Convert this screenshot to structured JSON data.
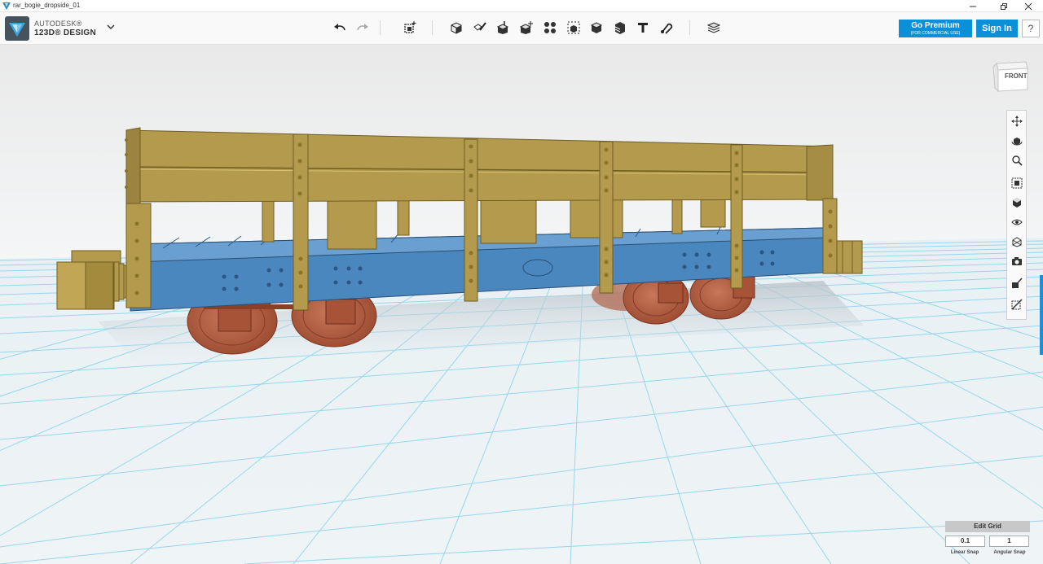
{
  "window": {
    "title": "rar_bogie_dropside_01"
  },
  "brand": {
    "line1": "AUTODESK®",
    "line2": "123D® DESIGN"
  },
  "toolbar": {
    "icons": [
      "undo-icon",
      "redo-icon",
      "transform-icon",
      "primitives-icon",
      "sketch-icon",
      "construct-icon",
      "modify-icon",
      "pattern-icon",
      "grouping-icon",
      "combine-icon",
      "measure-icon",
      "text-icon",
      "snap-icon",
      "material-icon"
    ]
  },
  "account": {
    "premium_label": "Go Premium",
    "premium_sub": "(FOR COMMERCIAL USE)",
    "signin_label": "Sign In",
    "help_label": "?"
  },
  "viewcube": {
    "face_label": "FRONT"
  },
  "grid": {
    "edit_label": "Edit Grid",
    "linear_value": "0.1",
    "angular_value": "1",
    "linear_label": "Linear Snap",
    "angular_label": "Angular Snap"
  },
  "colors": {
    "accent": "#0a90d8",
    "grid_line": "#7ccde8",
    "body_blue": "#4a87bf",
    "wood_tan": "#b39a4c",
    "wheel_red": "#b65d40"
  }
}
